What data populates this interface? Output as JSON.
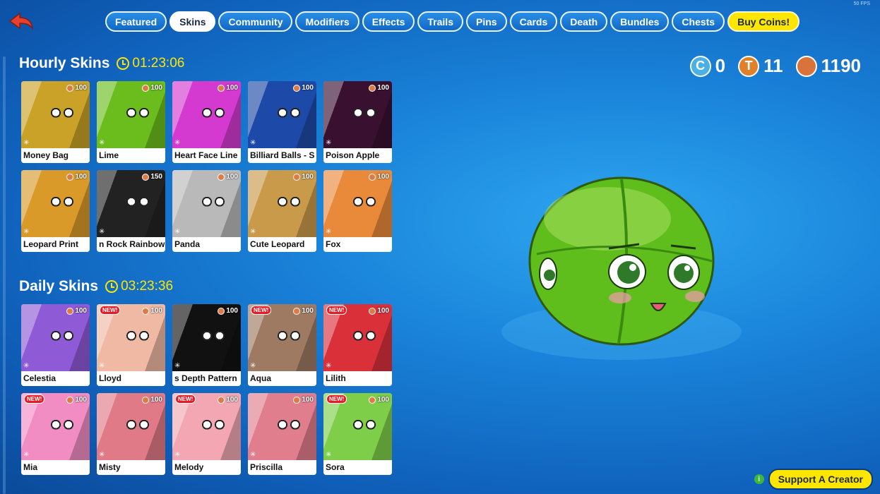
{
  "fps": "50 FPS",
  "nav": {
    "back_icon": "back-arrow-icon",
    "tabs": [
      {
        "label": "Featured",
        "active": false
      },
      {
        "label": "Skins",
        "active": true
      },
      {
        "label": "Community",
        "active": false
      },
      {
        "label": "Modifiers",
        "active": false
      },
      {
        "label": "Effects",
        "active": false
      },
      {
        "label": "Trails",
        "active": false
      },
      {
        "label": "Pins",
        "active": false
      },
      {
        "label": "Cards",
        "active": false
      },
      {
        "label": "Death",
        "active": false
      },
      {
        "label": "Bundles",
        "active": false
      },
      {
        "label": "Chests",
        "active": false
      }
    ],
    "buy_coins": "Buy Coins!"
  },
  "currency": {
    "c_value": "0",
    "t_value": "11",
    "coin_value": "1190"
  },
  "hourly": {
    "title": "Hourly Skins",
    "timer": "01:23:06",
    "skins": [
      {
        "name": "Money Bag",
        "price": "100",
        "new": false,
        "color": "#c9a227"
      },
      {
        "name": "Lime",
        "price": "100",
        "new": false,
        "color": "#6bbd1e"
      },
      {
        "name": "Heart Face Line",
        "price": "100",
        "new": false,
        "color": "#d43ad0"
      },
      {
        "name": "Billiard Balls - S",
        "price": "100",
        "new": false,
        "color": "#1d4aa8"
      },
      {
        "name": "Poison Apple",
        "price": "100",
        "new": false,
        "color": "#3a1030"
      },
      {
        "name": "Leopard Print",
        "price": "100",
        "new": false,
        "color": "#d99a2a"
      },
      {
        "name": "n Rock Rainbow",
        "price": "150",
        "new": false,
        "color": "#222222"
      },
      {
        "name": "Panda",
        "price": "100",
        "new": false,
        "color": "#b9b9b9"
      },
      {
        "name": "Cute Leopard",
        "price": "100",
        "new": false,
        "color": "#c99a4a"
      },
      {
        "name": "Fox",
        "price": "100",
        "new": false,
        "color": "#e9893a"
      }
    ]
  },
  "daily": {
    "title": "Daily Skins",
    "timer": "03:23:36",
    "skins": [
      {
        "name": "Celestia",
        "price": "100",
        "new": false,
        "color": "#8e5ad6"
      },
      {
        "name": "Lloyd",
        "price": "100",
        "new": true,
        "color": "#f0b9a4"
      },
      {
        "name": "s Depth Pattern",
        "price": "100",
        "new": false,
        "color": "#111111"
      },
      {
        "name": "Aqua",
        "price": "100",
        "new": true,
        "color": "#9e7a62"
      },
      {
        "name": "Lilith",
        "price": "100",
        "new": true,
        "color": "#d9303a"
      },
      {
        "name": "Mia",
        "price": "100",
        "new": true,
        "color": "#f28dc4"
      },
      {
        "name": "Misty",
        "price": "100",
        "new": false,
        "color": "#e07a86"
      },
      {
        "name": "Melody",
        "price": "100",
        "new": true,
        "color": "#f2a7b2"
      },
      {
        "name": "Priscilla",
        "price": "100",
        "new": false,
        "color": "#e17e8e"
      },
      {
        "name": "Sora",
        "price": "100",
        "new": true,
        "color": "#7fce4a"
      }
    ]
  },
  "support": {
    "label": "Support A Creator",
    "info_icon": "info-icon"
  }
}
